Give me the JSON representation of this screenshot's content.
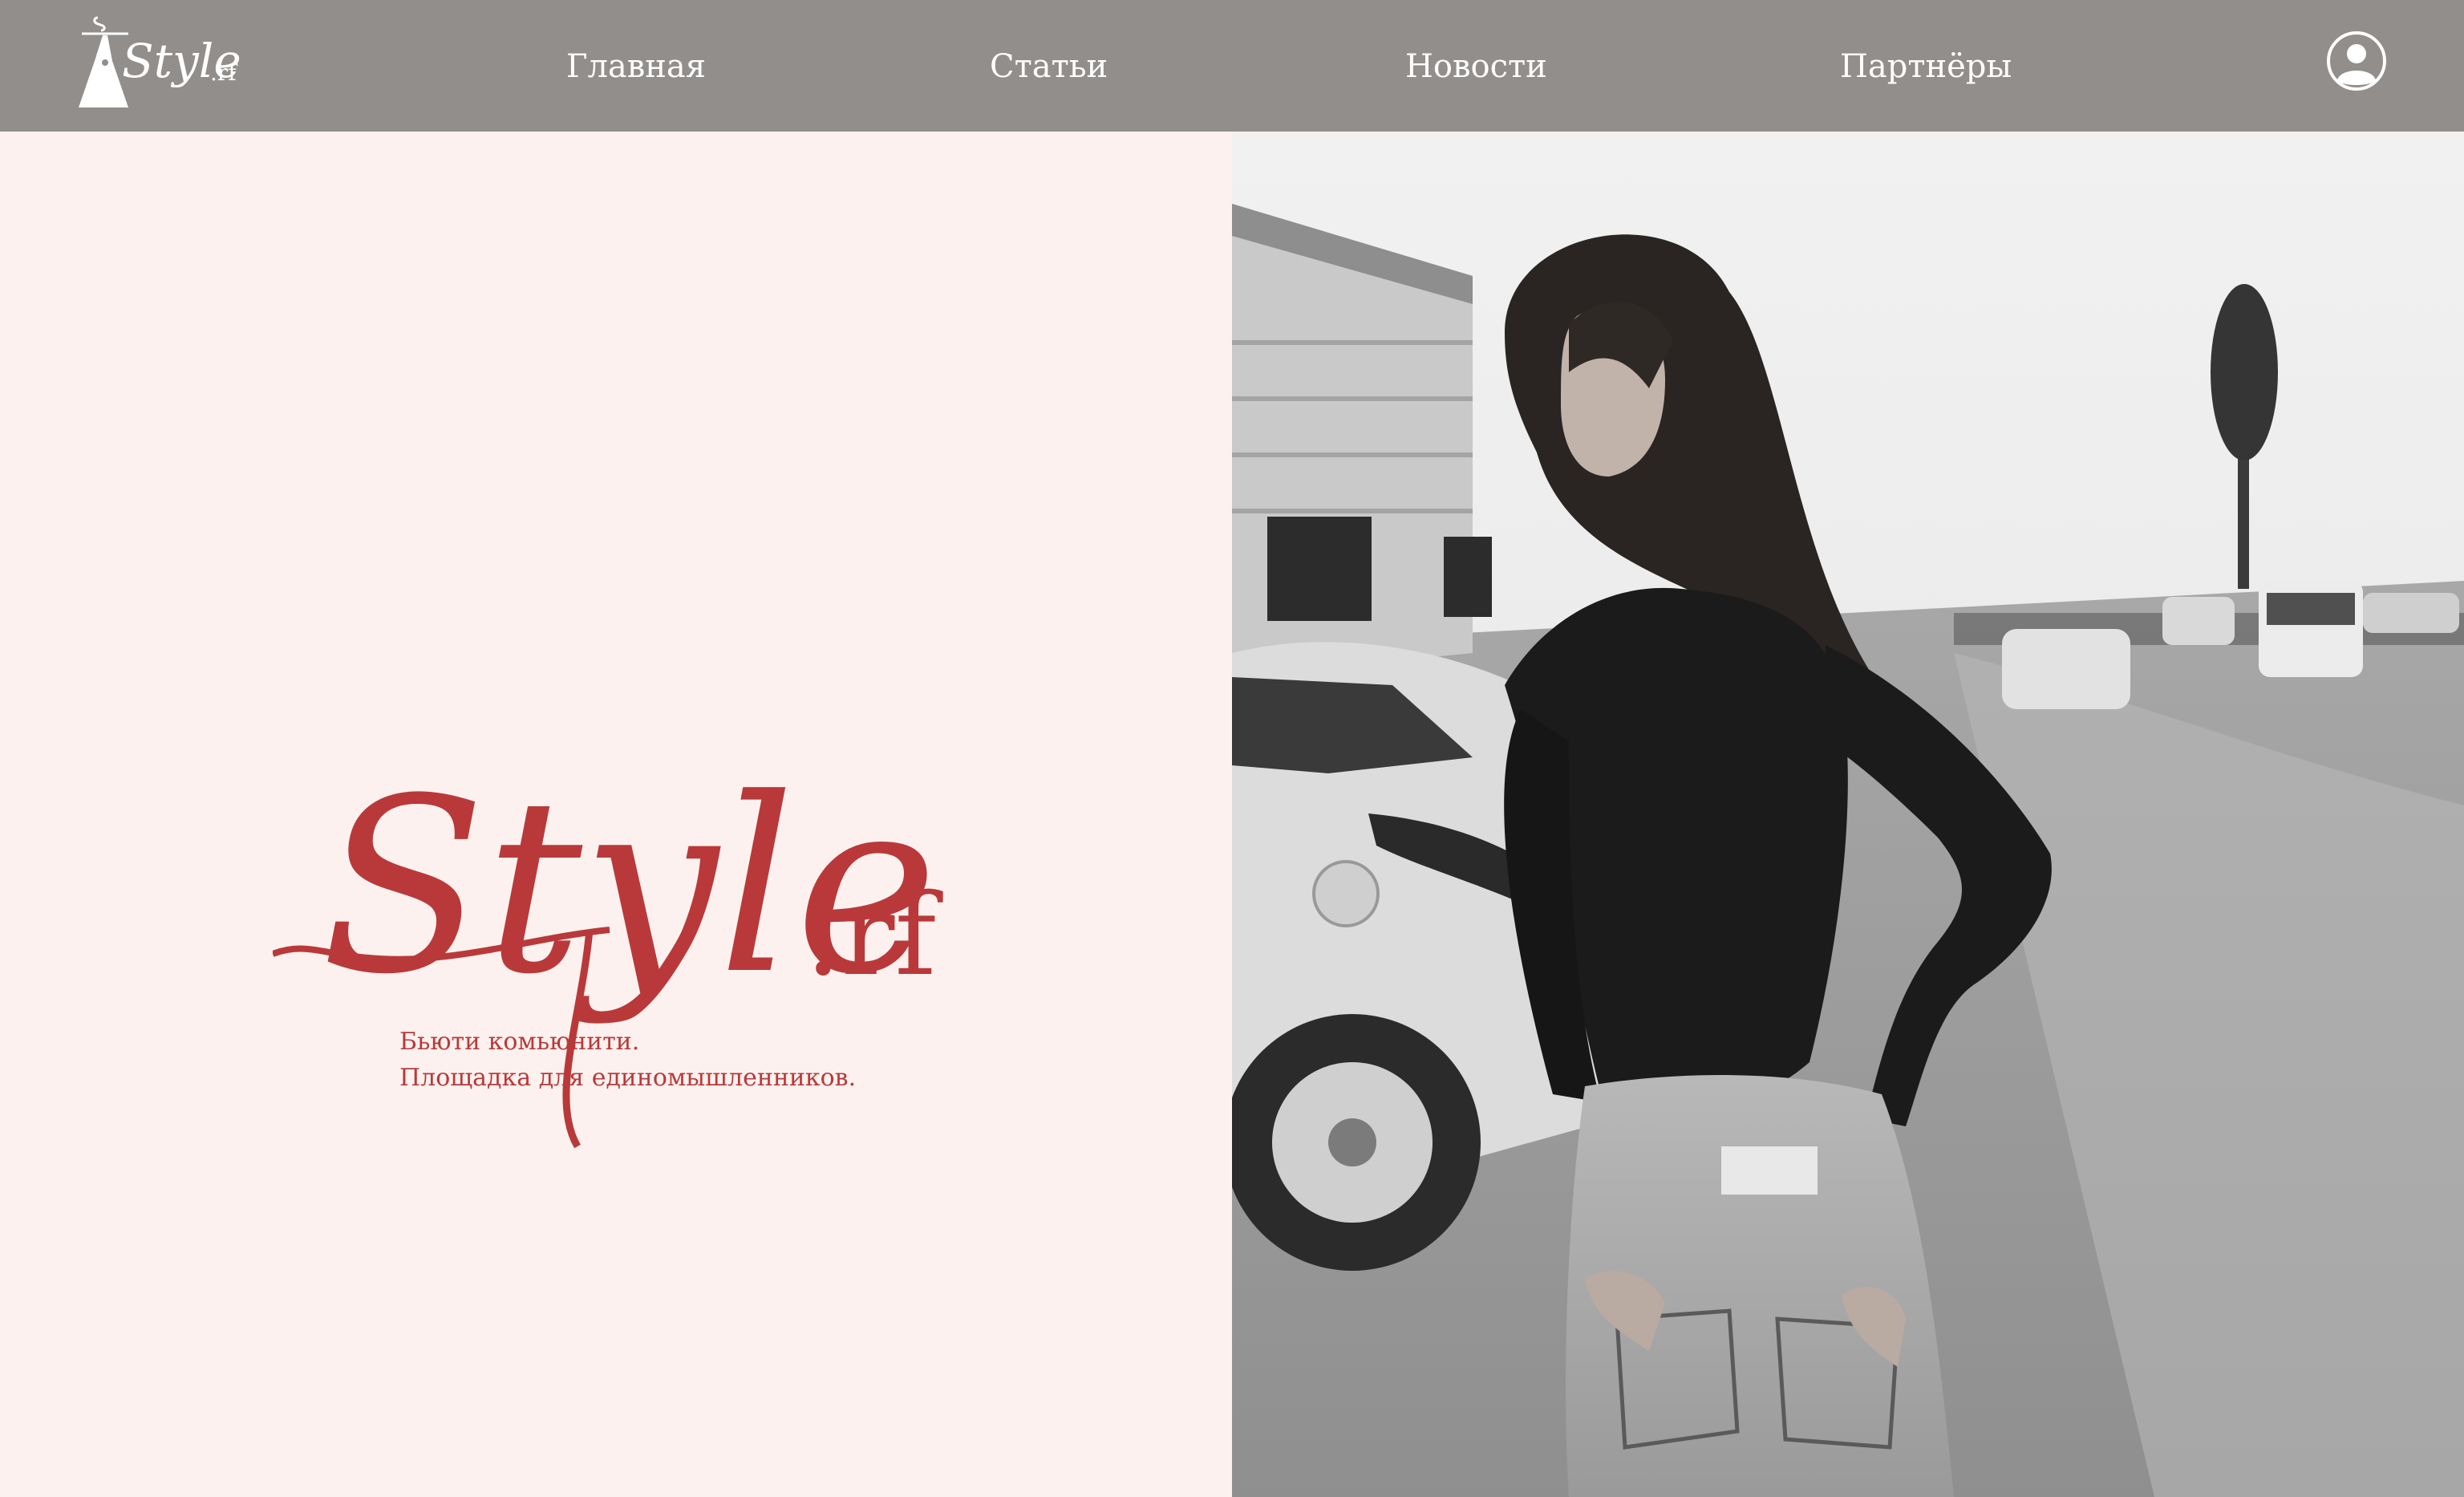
{
  "brand": {
    "name": "Style.rf",
    "wordmark_main": "Style",
    "wordmark_suffix": ".rf",
    "accent_color": "#b9393a"
  },
  "nav": {
    "items": [
      {
        "label": "Главная"
      },
      {
        "label": "Статьи"
      },
      {
        "label": "Новости"
      },
      {
        "label": "Партнёры"
      }
    ],
    "background": "#928e8b",
    "profile_icon": "user-avatar-icon"
  },
  "hero": {
    "tagline_line1": "Бьюти комьюнити.",
    "tagline_line2": "Площадка для единомышленников.",
    "background": "#fcf1ee",
    "photo": "black-and-white photo of a woman in a black turtleneck and jeans in a parking lot"
  }
}
